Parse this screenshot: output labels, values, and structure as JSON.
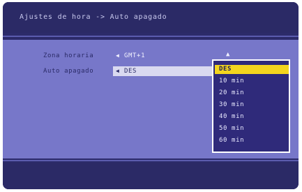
{
  "title": "Ajustes de hora -> Auto apagado",
  "rows": [
    {
      "label": "Zona horaria",
      "value": "GMT+1"
    },
    {
      "label": "Auto apagado",
      "value": "DES"
    }
  ],
  "dropdown": {
    "selected": "DES",
    "options": [
      "DES",
      "10 min",
      "20 min",
      "30 min",
      "40 min",
      "50 min",
      "60 min"
    ]
  },
  "colors": {
    "background": "#2c2b6a",
    "panel": "#7777c9",
    "highlight": "#f4d51e"
  }
}
